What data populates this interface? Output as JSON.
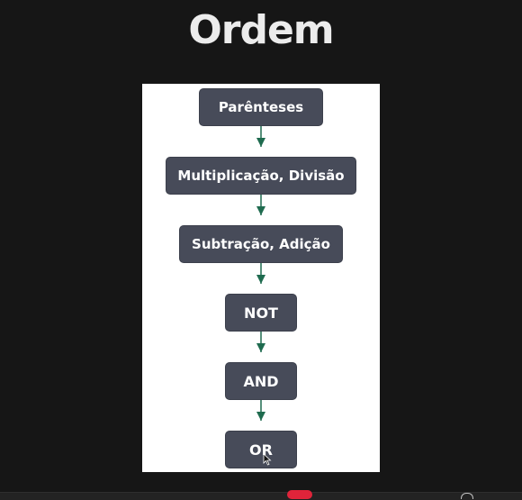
{
  "title": "Ordem",
  "flowchart": {
    "nodes": [
      {
        "id": "n1",
        "label": "Parênteses"
      },
      {
        "id": "n2",
        "label": "Multiplicação, Divisão"
      },
      {
        "id": "n3",
        "label": "Subtração, Adição"
      },
      {
        "id": "n4",
        "label": "NOT"
      },
      {
        "id": "n5",
        "label": "AND"
      },
      {
        "id": "n6",
        "label": "OR"
      }
    ],
    "edges": [
      {
        "from": "n1",
        "to": "n2"
      },
      {
        "from": "n2",
        "to": "n3"
      },
      {
        "from": "n3",
        "to": "n4"
      },
      {
        "from": "n4",
        "to": "n5"
      },
      {
        "from": "n5",
        "to": "n6"
      }
    ]
  },
  "colors": {
    "background": "#161616",
    "panel": "#ffffff",
    "node_fill": "#474b59",
    "node_text": "#ffffff",
    "arrow": "#1f6b4f",
    "title": "#ececec"
  }
}
